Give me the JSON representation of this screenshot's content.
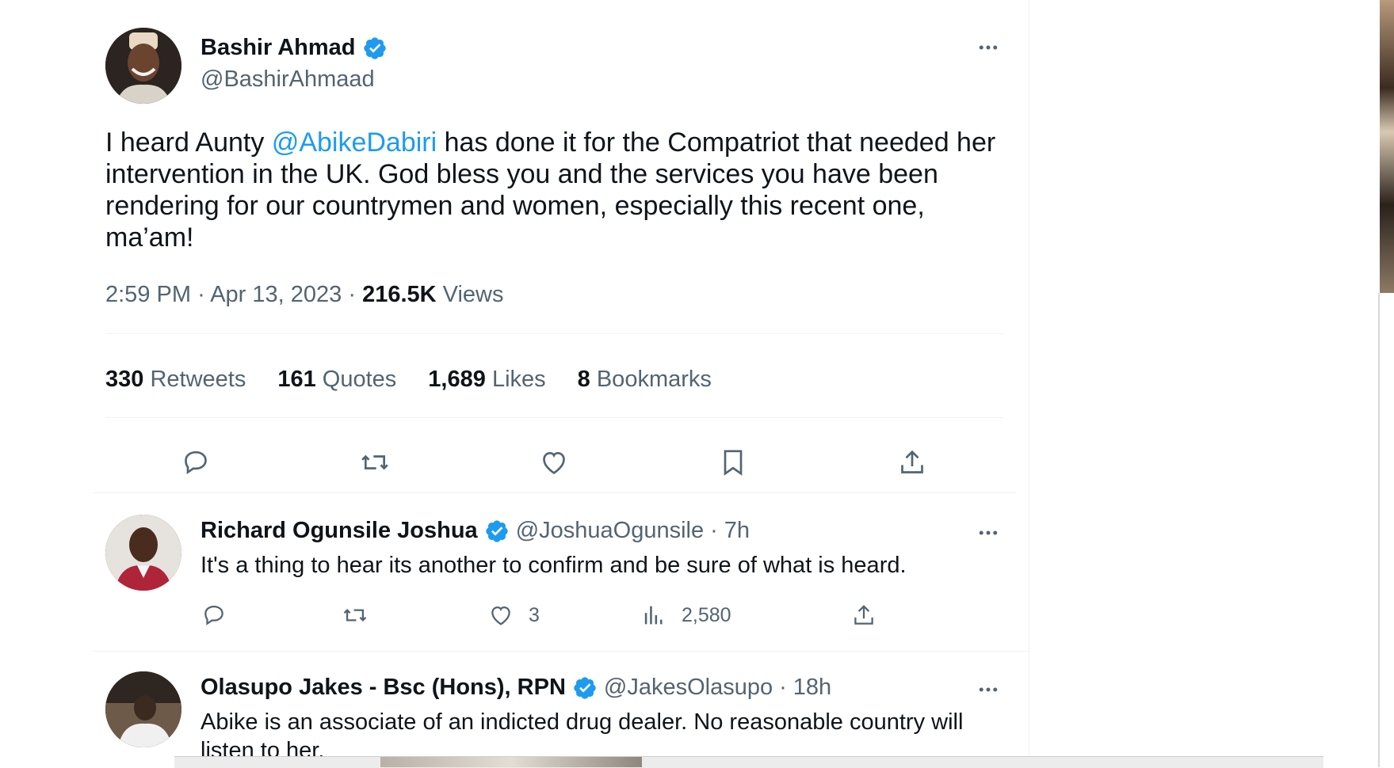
{
  "main_tweet": {
    "author_name": "Bashir Ahmad",
    "author_handle": "@BashirAhmaad",
    "text_before": "I heard Aunty ",
    "mention": "@AbikeDabiri",
    "text_after": " has done it for the Compatriot that needed her intervention in the UK. God bless you and the services you have been rendering for our countrymen and women, especially this recent one, ma’am!",
    "time": "2:59 PM",
    "sep": "·",
    "date": "Apr 13, 2023",
    "views_count": "216.5K",
    "views_label": "Views",
    "stats": {
      "retweets_count": "330",
      "retweets_label": "Retweets",
      "quotes_count": "161",
      "quotes_label": "Quotes",
      "likes_count": "1,689",
      "likes_label": "Likes",
      "bookmarks_count": "8",
      "bookmarks_label": "Bookmarks"
    },
    "actions": [
      "reply-icon",
      "retweet-icon",
      "like-icon",
      "bookmark-icon",
      "share-icon"
    ]
  },
  "replies": [
    {
      "author_name": "Richard Ogunsile Joshua",
      "author_handle": "@JoshuaOgunsile",
      "sep": "·",
      "time": "7h",
      "text": "It's a thing to hear its another to confirm and be sure of what is heard.",
      "likes": "3",
      "views": "2,580"
    },
    {
      "author_name": "Olasupo Jakes - Bsc (Hons), RPN",
      "author_handle": "@JakesOlasupo",
      "sep": "·",
      "time": "18h",
      "text": "Abike is an associate of an indicted drug dealer. No reasonable country will listen to her."
    }
  ],
  "colors": {
    "accent": "#1d9bf0",
    "text": "#0f1419",
    "muted": "#536471",
    "divider": "#eff3f4"
  }
}
